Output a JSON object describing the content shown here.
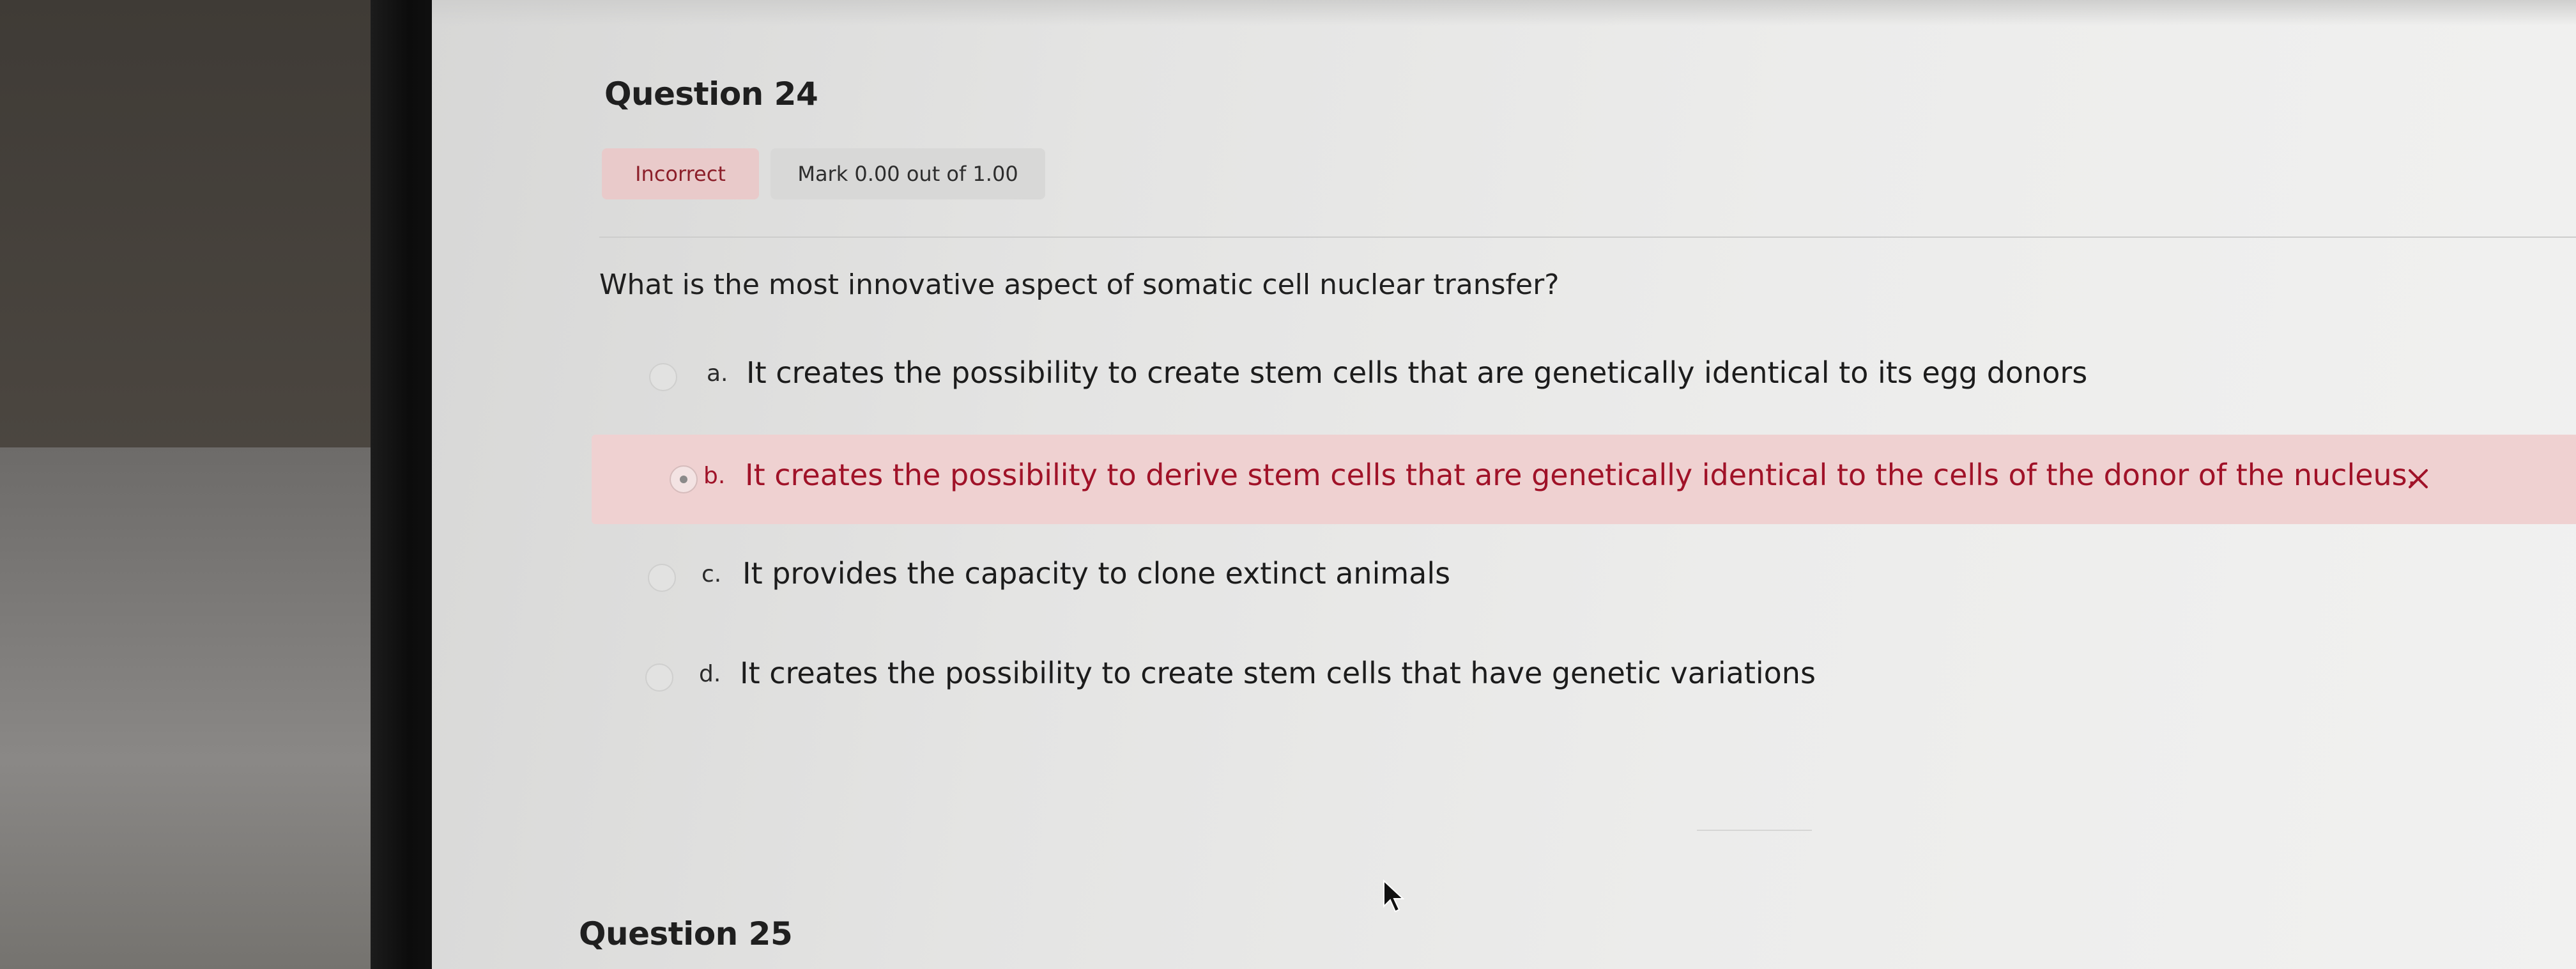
{
  "question": {
    "title": "Question 24",
    "status_badge": "Incorrect",
    "mark_badge": "Mark 0.00 out of 1.00",
    "text": "What is the most innovative aspect of somatic cell nuclear transfer?",
    "options": [
      {
        "letter": "a.",
        "text": "It creates the possibility to create stem cells that are genetically identical to its egg donors",
        "selected": false,
        "result": ""
      },
      {
        "letter": "b.",
        "text": "It creates the possibility to derive stem cells that are genetically identical to the cells of the donor of the nucleus.",
        "selected": true,
        "result": "incorrect",
        "result_icon": "cross-icon"
      },
      {
        "letter": "c.",
        "text": "It provides the capacity to clone extinct animals",
        "selected": false,
        "result": ""
      },
      {
        "letter": "d.",
        "text": "It creates the possibility to create stem cells that have genetic variations",
        "selected": false,
        "result": ""
      }
    ]
  },
  "next_question": {
    "title": "Question 25"
  },
  "colors": {
    "incorrect_text": "#a01228",
    "incorrect_bg": "#efd1d1",
    "badge_incorrect_bg": "#e9caca",
    "badge_mark_bg": "#d8d8d7"
  }
}
